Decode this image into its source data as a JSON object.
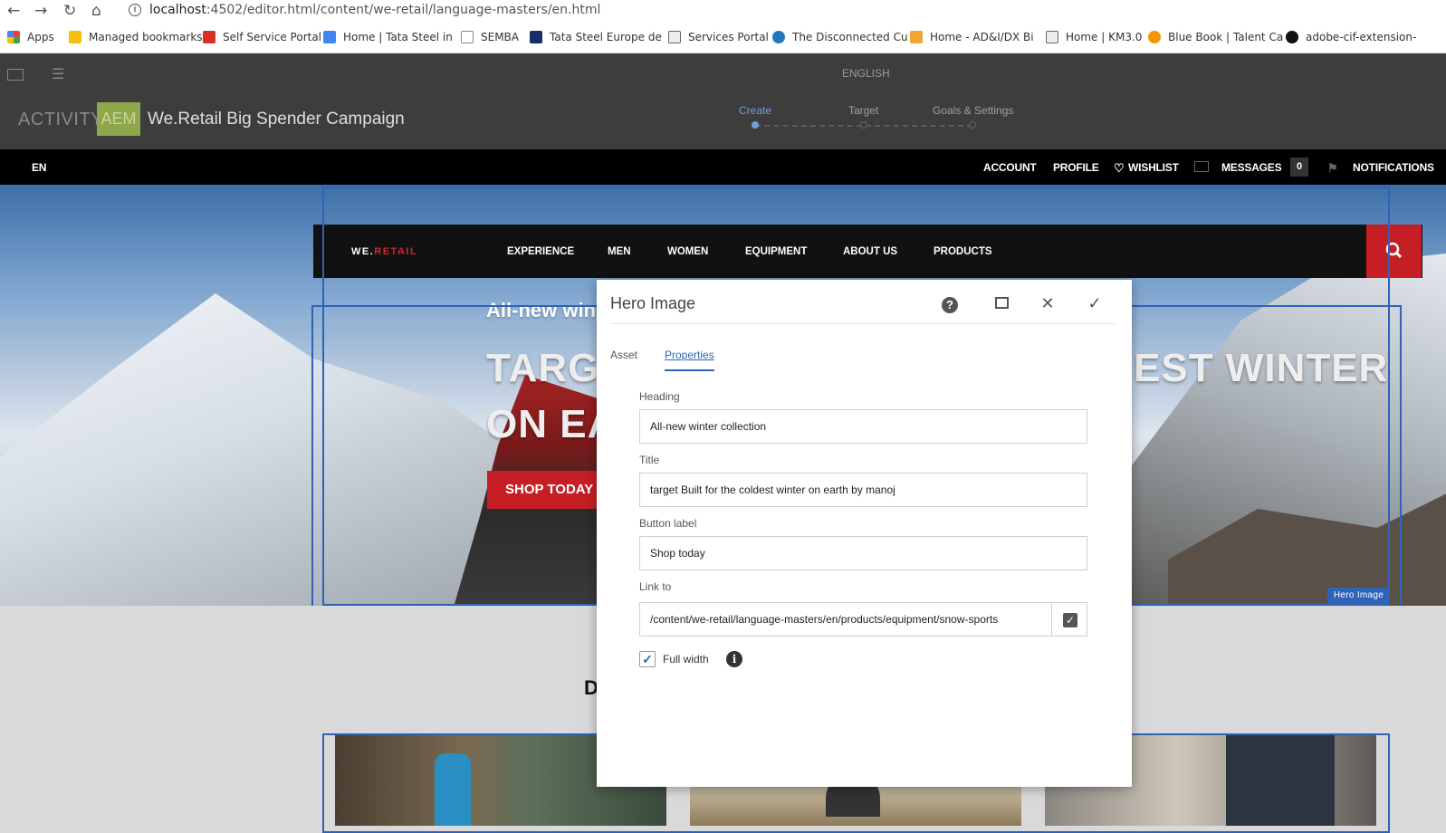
{
  "browser": {
    "url_host": "localhost",
    "url_path": ":4502/editor.html/content/we-retail/language-masters/en.html",
    "bookmarks": [
      {
        "label": "Apps",
        "icon": "apps-grid-icon",
        "color": "#e94235"
      },
      {
        "label": "Managed bookmarks",
        "icon": "folder-icon",
        "color": "#f4c20d"
      },
      {
        "label": "Self Service Portal",
        "icon": "site-icon",
        "color": "#d93025"
      },
      {
        "label": "Home | Tata Steel in",
        "icon": "site-icon",
        "color": "#4285f4"
      },
      {
        "label": "SEMBA",
        "icon": "page-icon",
        "color": "#888888"
      },
      {
        "label": "Tata Steel Europe de",
        "icon": "tool-icon",
        "color": "#1a2d6b"
      },
      {
        "label": "Services Portal",
        "icon": "chart-icon",
        "color": "#666666"
      },
      {
        "label": "The Disconnected Cu",
        "icon": "cloud-icon",
        "color": "#1f78c1"
      },
      {
        "label": "Home - AD&I/DX Bi",
        "icon": "site-icon",
        "color": "#f4a52d"
      },
      {
        "label": "Home | KM3.0",
        "icon": "chart-icon",
        "color": "#666666"
      },
      {
        "label": "Blue Book | Talent Ca",
        "icon": "site-icon",
        "color": "#f29900"
      },
      {
        "label": "adobe-cif-extension-",
        "icon": "github-icon",
        "color": "#111111"
      }
    ]
  },
  "editor": {
    "language": "ENGLISH",
    "activity_label": "ACTIVITY:",
    "aem_badge": "AEM",
    "campaign_name": "We.Retail Big Spender Campaign",
    "steps": [
      "Create",
      "Target",
      "Goals & Settings"
    ],
    "active_step_color": "#6fa0e0"
  },
  "site_topnav": {
    "lang": "EN",
    "account": "ACCOUNT",
    "profile": "PROFILE",
    "wishlist": "WISHLIST",
    "messages": "MESSAGES",
    "messages_count": "0",
    "notifications": "NOTIFICATIONS"
  },
  "site_mainnav": {
    "logo_a": "WE.",
    "logo_b": "RETAIL",
    "items": [
      "EXPERIENCE",
      "MEN",
      "WOMEN",
      "EQUIPMENT",
      "ABOUT US",
      "PRODUCTS"
    ]
  },
  "hero": {
    "sub_visible": "All-new win",
    "line1_left": "TARG",
    "line1_right": "EST WINTER",
    "line2_left": "ON EA",
    "button_visible": "SHOP TODAY",
    "component_label": "Hero Image"
  },
  "lower": {
    "heading_visible": "D"
  },
  "dialog": {
    "title": "Hero Image",
    "tabs": [
      "Asset",
      "Properties"
    ],
    "active_tab": "Properties",
    "fields": {
      "heading_label": "Heading",
      "heading_value": "All-new winter collection",
      "title_label": "Title",
      "title_value": "target Built for the coldest winter on earth by manoj",
      "button_label_label": "Button label",
      "button_label_value": "Shop today",
      "link_label": "Link to",
      "link_value": "/content/we-retail/language-masters/en/products/equipment/snow-sports"
    },
    "full_width_label": "Full width",
    "full_width_checked": true
  }
}
